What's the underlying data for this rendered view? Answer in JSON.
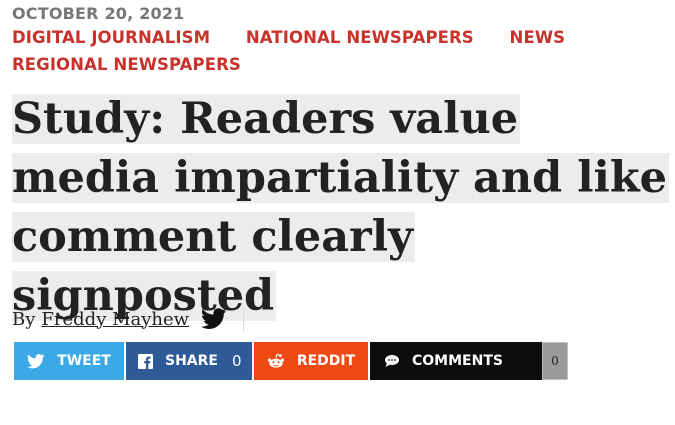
{
  "article": {
    "date": "OCTOBER 20, 2021",
    "categories": [
      "DIGITAL JOURNALISM",
      "NATIONAL NEWSPAPERS",
      "NEWS",
      "REGIONAL NEWSPAPERS"
    ],
    "title": "Study: Readers value media impartiality and like comment clearly signposted",
    "byline_prefix": "By",
    "author": "Freddy Mayhew"
  },
  "share_bar": {
    "tweet_label": "TWEET",
    "share_label": "SHARE",
    "share_count": "0",
    "reddit_label": "REDDIT",
    "comments_label": "COMMENTS",
    "comments_count": "0"
  },
  "icons": {
    "byline_social": "twitter-bird-icon",
    "tweet": "twitter-bird-icon",
    "share": "facebook-icon",
    "reddit": "reddit-icon",
    "comments": "speech-bubble-icon"
  },
  "colors": {
    "category": "#c8322a",
    "tweet": "#3ba9e6",
    "facebook": "#2e5a98",
    "reddit": "#f04a14",
    "comments": "#0d0d0d",
    "title_highlight": "#ececec"
  }
}
